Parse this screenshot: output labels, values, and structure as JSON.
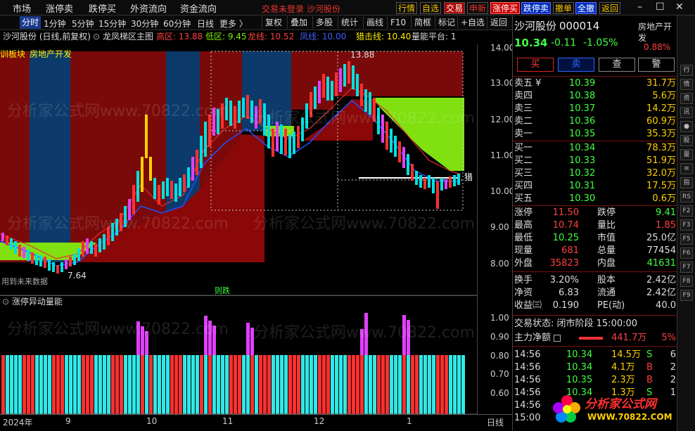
{
  "menu": [
    "市场",
    "涨停卖",
    "跌停买",
    "外资流向",
    "资金流向"
  ],
  "status_text": "交易未登录 沙河股份",
  "top_buttons": [
    "行情",
    "自选",
    "交易",
    "申新",
    "涨停买",
    "跌停卖",
    "撤单",
    "全撤",
    "返回"
  ],
  "tabs": [
    "分时",
    "1分钟",
    "5分钟",
    "15分钟",
    "30分钟",
    "60分钟",
    "日线",
    "更多 〉"
  ],
  "tools": [
    "复权",
    "叠加",
    "多股",
    "统计",
    "画线",
    "F10",
    "简框",
    "标记",
    "+自选",
    "返回"
  ],
  "chart_header": {
    "name": "沙河股份 (日线,前复权)",
    "indicator": "龙凤梯区主图",
    "high": "高区: 13.88",
    "low": "低区: 9.45",
    "dragon": "龙线: 10.52",
    "wx": "凤线: 10.00",
    "hunt": "猎击线: 10.40",
    "platform": "量能平台: 1"
  },
  "sector_labels": [
    "训板块",
    "房地产开发"
  ],
  "annotations": {
    "high_mark": "13.88",
    "low_mark": "7.64",
    "hunt_tag": "猎",
    "future_note": "用到未来数据",
    "fall_tag": "则跌"
  },
  "price_axis": [
    "14.00",
    "13.00",
    "12.00",
    "11.00",
    "10.00",
    "9.00",
    "8.00"
  ],
  "sub_title": "涨停异动量能",
  "sub_axis": [
    "1.00",
    "0.90",
    "0.80",
    "0.70",
    "0.60"
  ],
  "x_axis": [
    "2024年",
    "9",
    "10",
    "11",
    "12",
    "1",
    "日线"
  ],
  "quote": {
    "name": "沙河股份",
    "code": "000014",
    "sector": "房地产开发",
    "sector_pct": "0.88%",
    "price": "10.34",
    "change": "-0.11",
    "pct": "-1.05%",
    "actions": [
      "买",
      "卖",
      "查",
      "警"
    ],
    "asks": [
      [
        "卖五 ¥",
        "10.39",
        "31.7万"
      ],
      [
        "卖四",
        "10.38",
        "5.6万"
      ],
      [
        "卖三",
        "10.37",
        "14.2万"
      ],
      [
        "卖二",
        "10.36",
        "60.9万"
      ],
      [
        "卖一",
        "10.35",
        "35.3万"
      ]
    ],
    "bids": [
      [
        "买一",
        "10.34",
        "78.3万"
      ],
      [
        "买二",
        "10.33",
        "51.9万"
      ],
      [
        "买三",
        "10.32",
        "32.0万"
      ],
      [
        "买四",
        "10.31",
        "17.5万"
      ],
      [
        "买五",
        "10.30",
        "0.6万"
      ]
    ],
    "stats": [
      [
        "涨停",
        "11.50",
        "跌停",
        "9.41"
      ],
      [
        "最高",
        "10.74",
        "量比",
        "1.85"
      ],
      [
        "最低",
        "10.25",
        "市值",
        "25.0亿"
      ],
      [
        "现量",
        "681",
        "总量",
        "77454"
      ],
      [
        "外盘",
        "35823",
        "内盘",
        "41631"
      ]
    ],
    "stats2": [
      [
        "换手",
        "3.20%",
        "股本",
        "2.42亿"
      ],
      [
        "净资",
        "6.83",
        "流通",
        "2.42亿"
      ],
      [
        "收益㈢",
        "0.190",
        "PE(动)",
        "40.0"
      ]
    ],
    "trade_status": "交易状态: 闭市阶段 15:00:00",
    "main_flow_label": "主力净额",
    "main_flow_value": "441.7万",
    "main_flow_pct": "5%",
    "ticks": [
      [
        "14:56",
        "10.34",
        "14.5万",
        "S",
        "6"
      ],
      [
        "14:56",
        "10.34",
        "4.1万",
        "B",
        "2"
      ],
      [
        "14:56",
        "10.35",
        "2.3万",
        "B",
        "2"
      ],
      [
        "14:56",
        "10.34",
        "1.3万",
        "S",
        "1"
      ],
      [
        "14:56",
        "",
        "",
        "",
        ""
      ],
      [
        "15:00",
        "",
        "",
        "",
        ""
      ]
    ]
  },
  "watermark": "分析家公式网www.70822.com",
  "logo": {
    "text": "分析家公式网",
    "url": "WWW.70822.COM"
  },
  "strip": [
    "行",
    "情",
    "资",
    "讯",
    "●",
    "股",
    "量",
    "≡",
    "指",
    "RS",
    "F2",
    "F3",
    "F5",
    "F6",
    "F7",
    "F8",
    "F9"
  ],
  "colors": {
    "up": "#ff3333",
    "down": "#00e0e0",
    "accent": "#f5c500",
    "bg": "#000000"
  }
}
